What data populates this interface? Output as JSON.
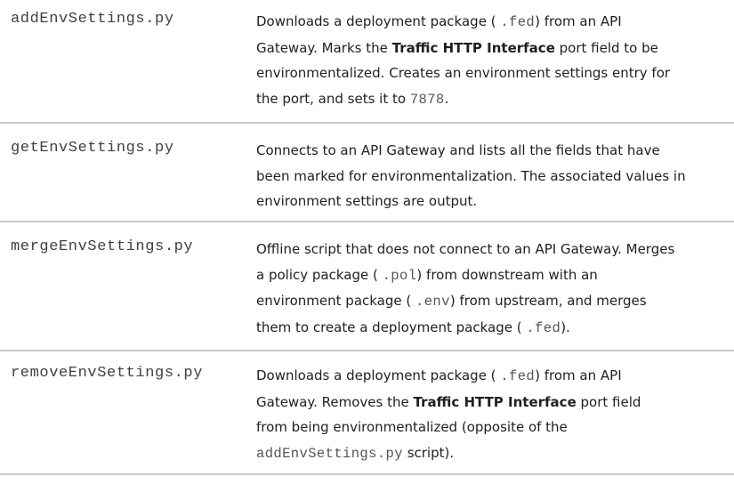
{
  "rows": [
    {
      "script": "addEnvSettings.py",
      "lines": [
        [
          "Downloads a deployment package ( ",
          ".fed",
          ") from an API"
        ],
        [
          "Gateway. Marks the ",
          "Traffic HTTP Interface",
          " port field to be"
        ],
        [
          "environmentalized. Creates an environment settings entry for"
        ],
        [
          "the port, and sets it to ",
          "7878",
          "."
        ]
      ]
    },
    {
      "script": "getEnvSettings.py",
      "lines": [
        [
          "Connects to an API Gateway and lists all the fields that have"
        ],
        [
          "been marked for environmentalization. The associated values in"
        ],
        [
          "environment settings are output."
        ]
      ]
    },
    {
      "script": "mergeEnvSettings.py",
      "lines": [
        [
          "Offline script that does not connect to an API Gateway. Merges"
        ],
        [
          "a policy package ( ",
          ".pol",
          ") from downstream with an"
        ],
        [
          "environment package ( ",
          ".env",
          ") from upstream, and merges"
        ],
        [
          "them to create a deployment package ( ",
          ".fed",
          ")."
        ]
      ]
    },
    {
      "script": "removeEnvSettings.py",
      "lines": [
        [
          "Downloads a deployment package ( ",
          ".fed",
          ") from an API"
        ],
        [
          "Gateway. Removes the ",
          "Traffic HTTP Interface",
          " port field"
        ],
        [
          "from being environmentalized (opposite of the"
        ],
        [
          "addEnvSettings.py",
          " script)."
        ]
      ]
    }
  ]
}
